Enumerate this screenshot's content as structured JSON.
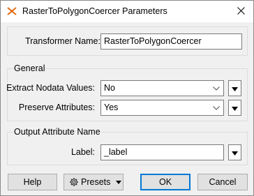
{
  "window": {
    "title": "RasterToPolygonCoercer Parameters"
  },
  "transformer": {
    "label": "Transformer Name:",
    "value": "RasterToPolygonCoercer"
  },
  "general": {
    "title": "General",
    "extract_nodata": {
      "label": "Extract Nodata Values:",
      "value": "No"
    },
    "preserve_attributes": {
      "label": "Preserve Attributes:",
      "value": "Yes"
    }
  },
  "output": {
    "title": "Output Attribute Name",
    "label_field": {
      "label": "Label:",
      "value": "_label"
    }
  },
  "buttons": {
    "help": "Help",
    "presets": "Presets",
    "ok": "OK",
    "cancel": "Cancel"
  }
}
